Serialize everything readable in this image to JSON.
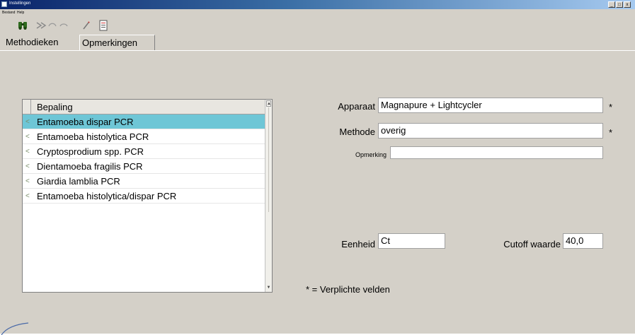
{
  "window": {
    "title": "Instellingen",
    "controls": [
      "_",
      "□",
      "x"
    ]
  },
  "menubar": {
    "items": [
      "Bestand",
      "Help"
    ]
  },
  "toolbar": {
    "icons": [
      "binoculars-icon",
      "forward-icon",
      "undo-icon",
      "redo-icon",
      "pencil-icon",
      "document-icon"
    ]
  },
  "tabs": [
    {
      "label": "Methodieken"
    },
    {
      "label": "Opmerkingen"
    }
  ],
  "list": {
    "header": "Bepaling",
    "items": [
      {
        "label": "Entamoeba dispar PCR",
        "selected": true
      },
      {
        "label": "Entamoeba histolytica PCR"
      },
      {
        "label": "Cryptosprodium spp. PCR"
      },
      {
        "label": "Dientamoeba fragilis PCR"
      },
      {
        "label": "Giardia lamblia PCR"
      },
      {
        "label": "Entamoeba histolytica/dispar PCR"
      }
    ],
    "row_mark": "<",
    "selected_color": "#6ec6d6"
  },
  "form": {
    "apparaat": {
      "label": "Apparaat",
      "value": "Magnapure + Lightcycler",
      "required_mark": "*"
    },
    "methode": {
      "label": "Methode",
      "value": "overig",
      "required_mark": "*"
    },
    "opmerking": {
      "label": "Opmerking",
      "value": ""
    },
    "eenheid": {
      "label": "Eenheid",
      "value": "Ct"
    },
    "cutoff": {
      "label": "Cutoff waarde",
      "value": "40,0"
    }
  },
  "footnote": "* = Verplichte velden"
}
